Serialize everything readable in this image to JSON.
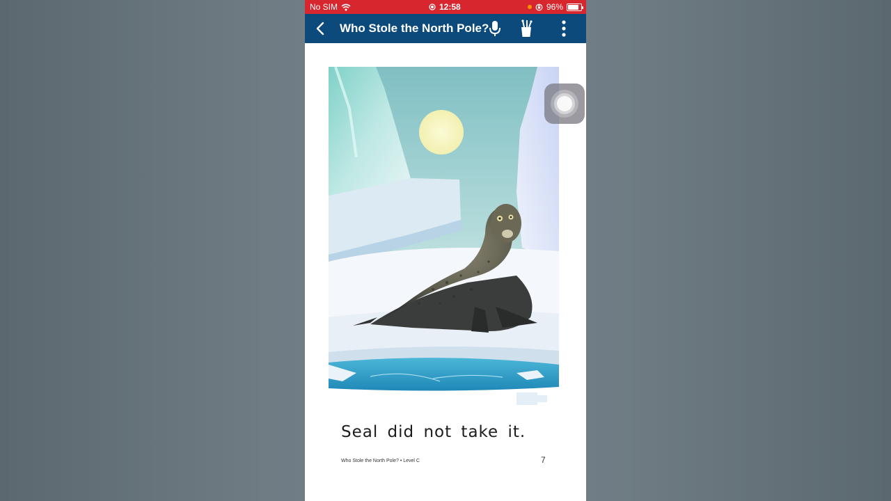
{
  "status_bar": {
    "carrier": "No SIM",
    "time": "12:58",
    "battery": "96%",
    "battery_level": 0.96
  },
  "nav": {
    "title": "Who Stole the North Pole?",
    "icons": [
      "back-icon",
      "microphone-icon",
      "tools-cup-icon",
      "more-vertical-icon"
    ]
  },
  "page": {
    "story_text": "Seal did not take it.",
    "footer_title": "Who Stole the North Pole? • Level C",
    "page_number": "7"
  },
  "colors": {
    "status_bar": "#d7262e",
    "nav_bar": "#0c4a7c"
  }
}
